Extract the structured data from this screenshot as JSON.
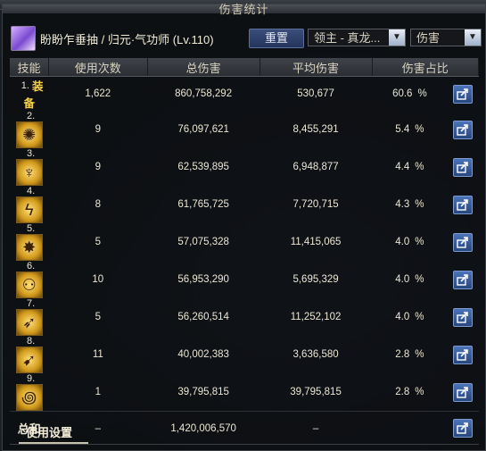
{
  "panel_title": "伤害统计",
  "character": {
    "name": "盼盼乍垂抽 / 归元·气功师 (Lv.110)",
    "avatar_icon": "character-portrait-icon"
  },
  "header": {
    "reset_label": "重置",
    "mode_select": "领主 - 真龙...",
    "type_select": "伤害"
  },
  "columns": [
    "技能",
    "使用次数",
    "总伤害",
    "平均伤害",
    "伤害占比"
  ],
  "rows": [
    {
      "index": "1.",
      "label": "装备",
      "count": "1,622",
      "total": "860,758,292",
      "avg": "530,677",
      "pct": "60.6"
    },
    {
      "index": "2.",
      "icon": "skill-roar-icon",
      "count": "9",
      "total": "76,097,621",
      "avg": "8,455,291",
      "pct": "5.4"
    },
    {
      "index": "3.",
      "icon": "skill-aura-figure-icon",
      "count": "9",
      "total": "62,539,895",
      "avg": "6,948,877",
      "pct": "4.4"
    },
    {
      "index": "4.",
      "icon": "skill-lightning-hand-icon",
      "count": "8",
      "total": "61,765,725",
      "avg": "7,720,715",
      "pct": "4.3"
    },
    {
      "index": "5.",
      "icon": "skill-burst-icon",
      "count": "5",
      "total": "57,075,328",
      "avg": "11,415,065",
      "pct": "4.0"
    },
    {
      "index": "6.",
      "icon": "skill-clones-icon",
      "count": "10",
      "total": "56,953,290",
      "avg": "5,695,329",
      "pct": "4.0"
    },
    {
      "index": "7.",
      "icon": "skill-beam-icon",
      "count": "5",
      "total": "56,260,514",
      "avg": "11,252,102",
      "pct": "4.0"
    },
    {
      "index": "8.",
      "icon": "skill-dash-icon",
      "count": "11",
      "total": "40,002,383",
      "avg": "3,636,580",
      "pct": "2.8"
    },
    {
      "index": "9.",
      "icon": "skill-spiral-icon",
      "count": "1",
      "total": "39,795,815",
      "avg": "39,795,815",
      "pct": "2.8"
    }
  ],
  "pct_symbol": "%",
  "total_row": {
    "label": "总和",
    "count": "–",
    "total": "1,420,006,570",
    "avg": "–"
  },
  "footer": {
    "tab_label": "使用设置"
  },
  "colors": {
    "accent_gold": "#f6d04a",
    "button_blue": "#3b4e7a",
    "share_blue": "#4b73b8"
  }
}
